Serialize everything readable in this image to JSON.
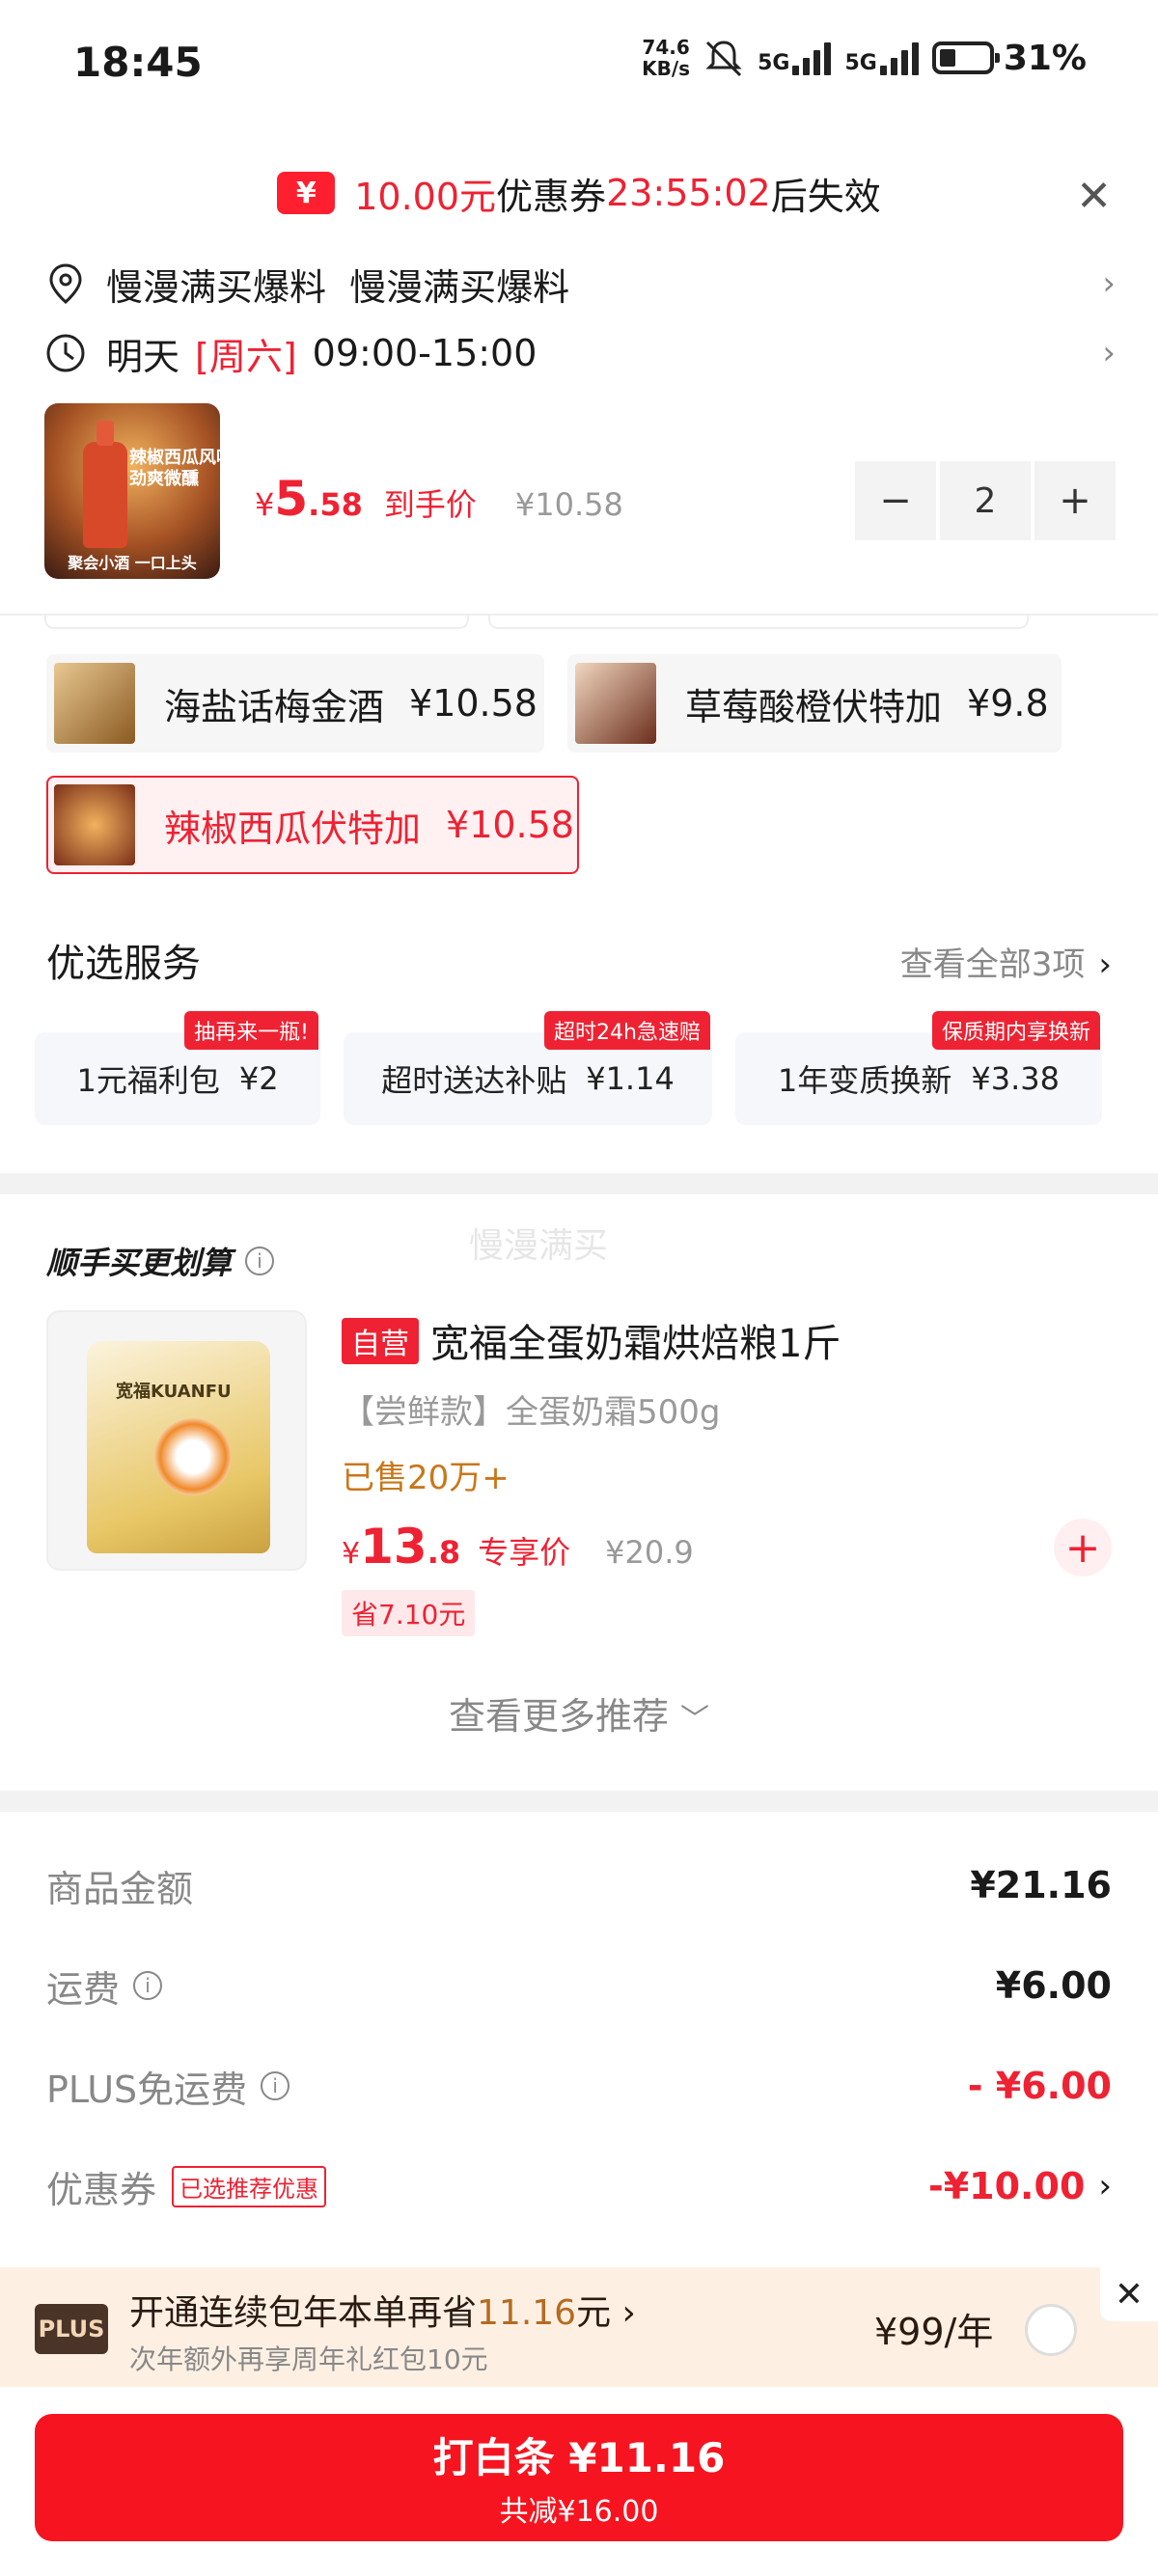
{
  "status": {
    "time": "18:45",
    "net_speed_value": "74.6",
    "net_speed_unit": "KB/s",
    "sig1": "5G",
    "sig2": "5G",
    "battery": "31%"
  },
  "coupon": {
    "amount": "10.00元",
    "text_mid": "优惠券",
    "countdown": "23:55:02",
    "text_end": "后失效"
  },
  "address": {
    "text": "慢漫满买爆料  慢漫满买爆料"
  },
  "delivery": {
    "day": "明天",
    "weekday": "[周六]",
    "window": "09:00-15:00"
  },
  "product": {
    "thumb_text": "辣椒西瓜风味\n劲爽微醺",
    "thumb_caption": "聚会小酒 一口上头",
    "price_yen": "¥",
    "price_int": "5",
    "price_dec": ".58",
    "price_label": "到手价",
    "price_orig": "¥10.58",
    "qty": "2"
  },
  "variants": [
    {
      "name": "海盐话梅金酒",
      "price": "¥10.58",
      "selected": false
    },
    {
      "name": "草莓酸橙伏特加",
      "price": "¥9.8",
      "selected": false
    },
    {
      "name": "辣椒西瓜伏特加",
      "price": "¥10.58",
      "selected": true
    }
  ],
  "services": {
    "title": "优选服务",
    "view_all": "查看全部3项",
    "items": [
      {
        "name": "1元福利包",
        "price": "¥2",
        "tag": "抽再来一瓶!"
      },
      {
        "name": "超时送达补贴",
        "price": "¥1.14",
        "tag": "超时24h急速赔"
      },
      {
        "name": "1年变质换新",
        "price": "¥3.38",
        "tag": "保质期内享换新"
      }
    ]
  },
  "recommend": {
    "title": "顺手买更划算",
    "watermark": "慢漫满买",
    "self_tag": "自营",
    "name": "宽福全蛋奶霜烘焙粮1斤",
    "sub": "【尝鲜款】全蛋奶霜500g",
    "sold": "已售20万+",
    "brand": "宽福KUANFU",
    "price_yen": "¥",
    "price_int": "13",
    "price_dec": ".8",
    "price_label": "专享价",
    "price_orig": "¥20.9",
    "save": "省7.10元",
    "more": "查看更多推荐"
  },
  "summary": {
    "goods_label": "商品金额",
    "goods_value": "¥21.16",
    "ship_label": "运费",
    "ship_value": "¥6.00",
    "plus_label": "PLUS免运费",
    "plus_value": "- ¥6.00",
    "coupon_label": "优惠券",
    "coupon_tag": "已选推荐优惠",
    "coupon_value": "-¥10.00"
  },
  "plus": {
    "logo": "PLUS",
    "main_a": "开通连续包年本单再省",
    "main_b": "11.16",
    "main_c": "元",
    "sub": "次年额外再享周年礼红包10元",
    "price": "¥99/年"
  },
  "pay": {
    "label": "打白条 ¥11.16",
    "sub": "共减¥16.00"
  },
  "colors": {
    "accent": "#ee2233",
    "button": "#f5141f",
    "plus_bg": "#fdf0e3"
  }
}
